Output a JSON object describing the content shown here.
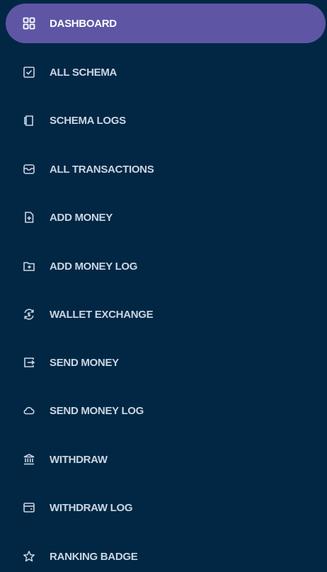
{
  "sidebar": {
    "items": [
      {
        "label": "DASHBOARD",
        "icon": "dashboard-grid-icon",
        "active": true
      },
      {
        "label": "ALL SCHEMA",
        "icon": "checkbox-icon",
        "active": false
      },
      {
        "label": "SCHEMA LOGS",
        "icon": "document-copy-icon",
        "active": false
      },
      {
        "label": "ALL TRANSACTIONS",
        "icon": "inbox-icon",
        "active": false
      },
      {
        "label": "ADD MONEY",
        "icon": "file-plus-icon",
        "active": false
      },
      {
        "label": "ADD MONEY LOG",
        "icon": "folder-plus-icon",
        "active": false
      },
      {
        "label": "WALLET EXCHANGE",
        "icon": "exchange-cycle-icon",
        "active": false
      },
      {
        "label": "SEND MONEY",
        "icon": "send-arrow-icon",
        "active": false
      },
      {
        "label": "SEND MONEY LOG",
        "icon": "cloud-icon",
        "active": false
      },
      {
        "label": "WITHDRAW",
        "icon": "bank-icon",
        "active": false
      },
      {
        "label": "WITHDRAW LOG",
        "icon": "wallet-card-icon",
        "active": false
      },
      {
        "label": "RANKING BADGE",
        "icon": "star-icon",
        "active": false
      }
    ]
  },
  "colors": {
    "background": "#022744",
    "active_background": "#5e56a5",
    "text": "#c9d6e3",
    "active_text": "#ffffff"
  }
}
